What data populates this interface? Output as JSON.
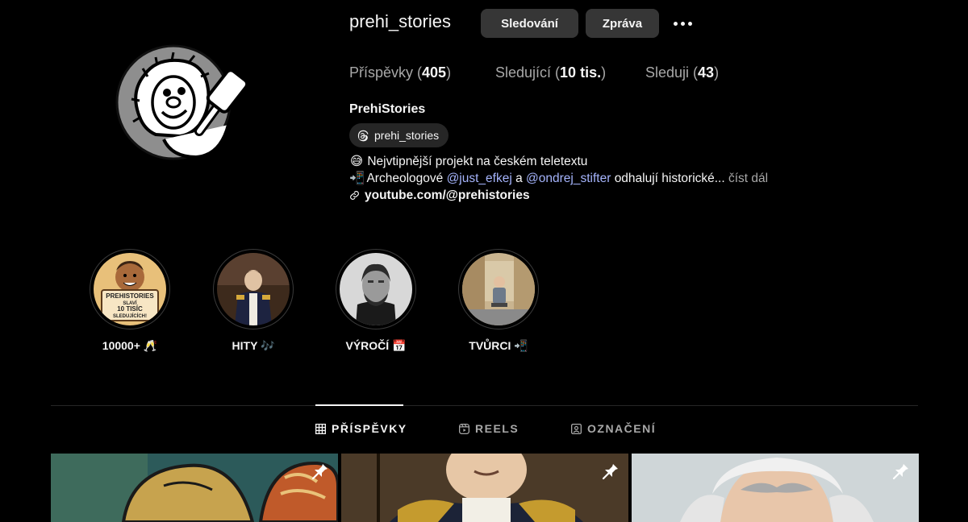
{
  "profile": {
    "username": "prehi_stories",
    "full_name": "PrehiStories",
    "threads_handle": "prehi_stories"
  },
  "actions": {
    "follow_label": "Sledování",
    "message_label": "Zpráva",
    "more_icon": "more-options-icon"
  },
  "stats": {
    "posts_label": "Příspěvky",
    "posts_value": "405",
    "followers_label": "Sledující",
    "followers_value": "10 tis.",
    "following_label": "Sleduji",
    "following_value": "43"
  },
  "bio": {
    "line1_emoji": "😅",
    "line1_text": "Nejvtipnější projekt na českém teletextu",
    "line2_emoji": "📲",
    "line2_pre": "Archeologové",
    "mention1": "@just_efkej",
    "line2_mid": "a",
    "mention2": "@ondrej_stifter",
    "line2_post": "odhalují historické...",
    "more_label": "číst dál",
    "link": "youtube.com/@prehistories"
  },
  "highlights": [
    {
      "label": "10000+ 🥂",
      "image_text": [
        "PREHISTORIES",
        "SLAVÍ",
        "10 TISÍC",
        "SLEDUJÍCÍCH!"
      ]
    },
    {
      "label": "HITY 🎶"
    },
    {
      "label": "VÝROČÍ 📅"
    },
    {
      "label": "TVŮRCI 📲"
    }
  ],
  "tabs": {
    "posts": "PŘÍSPĚVKY",
    "reels": "REELS",
    "tagged": "OZNAČENÍ",
    "active": "posts"
  },
  "colors": {
    "background": "#000000",
    "button": "#363636",
    "muted_text": "#a8a8a8",
    "mention": "#a5b4fc"
  }
}
